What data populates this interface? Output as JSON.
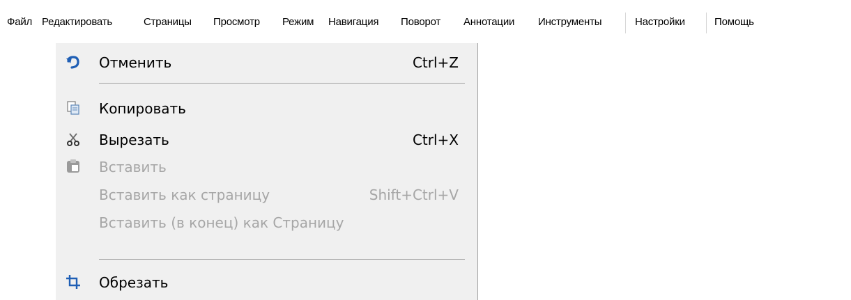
{
  "menubar": {
    "items": [
      {
        "label": "Файл"
      },
      {
        "label": "Редактировать"
      },
      {
        "label": "Страницы"
      },
      {
        "label": "Просмотр"
      },
      {
        "label": "Режим"
      },
      {
        "label": "Навигация"
      },
      {
        "label": "Поворот"
      },
      {
        "label": "Аннотации"
      },
      {
        "label": "Инструменты"
      },
      {
        "label": "Настройки"
      },
      {
        "label": "Помощь"
      }
    ]
  },
  "edit_menu": {
    "undo": {
      "label": "Отменить",
      "shortcut": "Ctrl+Z",
      "icon": "undo-icon",
      "enabled": true
    },
    "copy": {
      "label": "Копировать",
      "shortcut": "",
      "icon": "copy-icon",
      "enabled": true
    },
    "cut": {
      "label": "Вырезать",
      "shortcut": "Ctrl+X",
      "icon": "scissors-icon",
      "enabled": true
    },
    "paste": {
      "label": "Вставить",
      "shortcut": "",
      "icon": "paste-icon",
      "enabled": false
    },
    "paste_as_page": {
      "label": "Вставить как страницу",
      "shortcut": "Shift+Ctrl+V",
      "enabled": false
    },
    "paste_end_as_page": {
      "label": "Вставить (в конец) как Страницу",
      "shortcut": "",
      "enabled": false
    },
    "crop": {
      "label": "Обрезать",
      "shortcut": "",
      "icon": "crop-icon",
      "enabled": true
    }
  },
  "colors": {
    "menu_background": "#f0f0f0",
    "disabled_text": "#a6a6a6",
    "icon_blue": "#1f5fb5"
  }
}
